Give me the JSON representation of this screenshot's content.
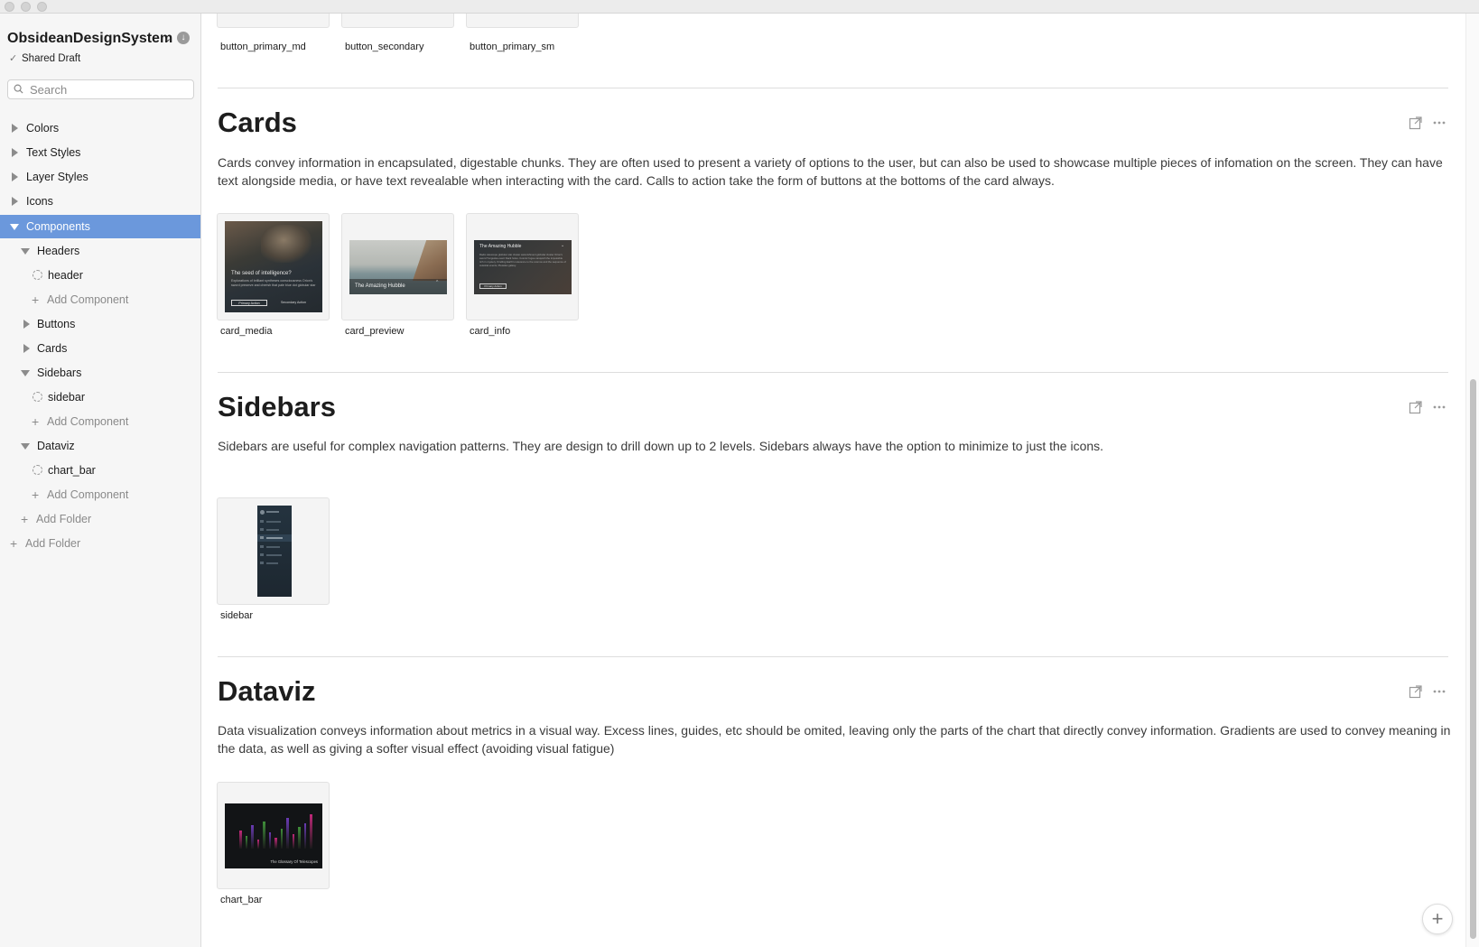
{
  "library": {
    "title": "ObsideanDesignSystem",
    "status": "Shared Draft"
  },
  "search": {
    "placeholder": "Search"
  },
  "tree": {
    "colors": "Colors",
    "text_styles": "Text Styles",
    "layer_styles": "Layer Styles",
    "icons": "Icons",
    "components": "Components",
    "headers": "Headers",
    "header": "header",
    "buttons": "Buttons",
    "cards": "Cards",
    "sidebars": "Sidebars",
    "sidebar": "sidebar",
    "dataviz": "Dataviz",
    "chart_bar": "chart_bar",
    "add_component": "Add Component",
    "add_folder": "Add Folder"
  },
  "buttons_row": {
    "labels": [
      "button_primary_md",
      "button_secondary",
      "button_primary_sm"
    ]
  },
  "sections": {
    "cards": {
      "title": "Cards",
      "description": "Cards convey information in encapsulated, digestable chunks. They are often used to present a variety of options to the user, but can also be used to showcase multiple pieces of infomation on the screen. They can have text alongside media, or have text revealable when interacting with the card. Calls to action take the form of buttons at the bottoms of the card always.",
      "items": [
        "card_media",
        "card_preview",
        "card_info"
      ],
      "card_media": {
        "heading": "The seed of intelligence?",
        "body": "Explorations of brilliant syntheses consciousness Orion's sword preserve and cherish that pale blue dot globular star",
        "primary": "Primary Action",
        "secondary": "Secondary Action"
      },
      "card_preview": {
        "heading": "The Amazing Hubble"
      },
      "card_info": {
        "heading": "The Amazing Hubble",
        "body": "Radio telescope globular star cluster astonishment globular cluster Orion's sword Tunguska event black holes. Cosmic fugue vanquish the impossible rich in mystery. Kindling Earth's relevance to the cosmos and the sequence of celestial events, Pleiades galaxy.",
        "primary": "Primary Action"
      }
    },
    "sidebars": {
      "title": "Sidebars",
      "description": "Sidebars are useful for complex navigation patterns. They are design to drill down up to 2 levels. Sidebars always have the option to minimize to just the icons.",
      "items": [
        "sidebar"
      ]
    },
    "dataviz": {
      "title": "Dataviz",
      "description": "Data visualization conveys information about metrics in a visual way. Excess lines, guides, etc should be omited, leaving only the parts of the chart that directly convey information. Gradients are used to convey meaning in the data, as well as giving a softer visual effect (avoiding visual fatigue)",
      "items": [
        "chart_bar"
      ],
      "chart_bar": {
        "caption": "The Glossary Of Telescopes"
      }
    }
  },
  "colors": {
    "selection": "#6b98dc",
    "sidebar_bg": "#f6f6f6",
    "card_dark": "#2b3238",
    "chart_magenta": "#c2287a",
    "chart_green": "#3f8f3a",
    "chart_purple": "#6a3bb5"
  },
  "icons": {
    "search": "search-icon",
    "open": "open-external-icon",
    "more": "more-icon",
    "add": "plus-icon",
    "component": "component-symbol-icon",
    "download": "download-icon"
  }
}
